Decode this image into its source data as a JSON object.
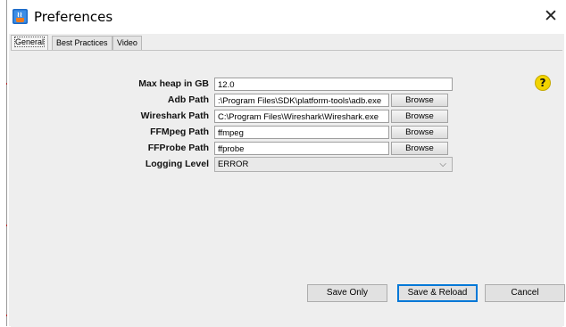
{
  "window": {
    "title": "Preferences",
    "close_glyph": "✕",
    "icon": "java-app-icon"
  },
  "tabs": [
    {
      "label": "General",
      "selected": true
    },
    {
      "label": "Best Practices",
      "selected": false
    },
    {
      "label": "Video",
      "selected": false
    }
  ],
  "help": {
    "glyph": "?",
    "icon": "help-icon"
  },
  "fields": {
    "max_heap": {
      "label": "Max heap in GB",
      "value": "12.0"
    },
    "adb": {
      "label": "Adb Path",
      "value": ":\\Program Files\\SDK\\platform-tools\\adb.exe",
      "browse": "Browse"
    },
    "wireshark": {
      "label": "Wireshark Path",
      "value": "C:\\Program Files\\Wireshark\\Wireshark.exe",
      "browse": "Browse"
    },
    "ffmpeg": {
      "label": "FFMpeg Path",
      "value": "ffmpeg",
      "browse": "Browse"
    },
    "ffprobe": {
      "label": "FFProbe Path",
      "value": "ffprobe",
      "browse": "Browse"
    },
    "logging": {
      "label": "Logging Level",
      "value": "ERROR"
    }
  },
  "buttons": {
    "save_only": "Save Only",
    "save_reload": "Save & Reload",
    "cancel": "Cancel"
  },
  "colors": {
    "panel_bg": "#eeeeee",
    "help_yellow": "#f2d400",
    "default_button_border": "#0078d7"
  }
}
